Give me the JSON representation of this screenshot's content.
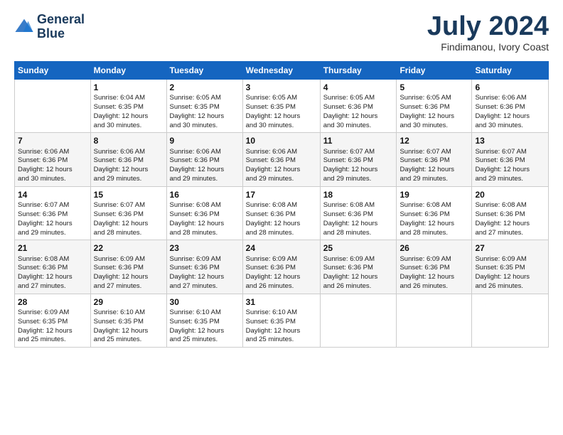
{
  "logo": {
    "line1": "General",
    "line2": "Blue"
  },
  "header": {
    "month": "July 2024",
    "location": "Findimanou, Ivory Coast"
  },
  "weekdays": [
    "Sunday",
    "Monday",
    "Tuesday",
    "Wednesday",
    "Thursday",
    "Friday",
    "Saturday"
  ],
  "weeks": [
    [
      {
        "day": "",
        "info": ""
      },
      {
        "day": "1",
        "info": "Sunrise: 6:04 AM\nSunset: 6:35 PM\nDaylight: 12 hours\nand 30 minutes."
      },
      {
        "day": "2",
        "info": "Sunrise: 6:05 AM\nSunset: 6:35 PM\nDaylight: 12 hours\nand 30 minutes."
      },
      {
        "day": "3",
        "info": "Sunrise: 6:05 AM\nSunset: 6:35 PM\nDaylight: 12 hours\nand 30 minutes."
      },
      {
        "day": "4",
        "info": "Sunrise: 6:05 AM\nSunset: 6:36 PM\nDaylight: 12 hours\nand 30 minutes."
      },
      {
        "day": "5",
        "info": "Sunrise: 6:05 AM\nSunset: 6:36 PM\nDaylight: 12 hours\nand 30 minutes."
      },
      {
        "day": "6",
        "info": "Sunrise: 6:06 AM\nSunset: 6:36 PM\nDaylight: 12 hours\nand 30 minutes."
      }
    ],
    [
      {
        "day": "7",
        "info": "Sunrise: 6:06 AM\nSunset: 6:36 PM\nDaylight: 12 hours\nand 30 minutes."
      },
      {
        "day": "8",
        "info": "Sunrise: 6:06 AM\nSunset: 6:36 PM\nDaylight: 12 hours\nand 29 minutes."
      },
      {
        "day": "9",
        "info": "Sunrise: 6:06 AM\nSunset: 6:36 PM\nDaylight: 12 hours\nand 29 minutes."
      },
      {
        "day": "10",
        "info": "Sunrise: 6:06 AM\nSunset: 6:36 PM\nDaylight: 12 hours\nand 29 minutes."
      },
      {
        "day": "11",
        "info": "Sunrise: 6:07 AM\nSunset: 6:36 PM\nDaylight: 12 hours\nand 29 minutes."
      },
      {
        "day": "12",
        "info": "Sunrise: 6:07 AM\nSunset: 6:36 PM\nDaylight: 12 hours\nand 29 minutes."
      },
      {
        "day": "13",
        "info": "Sunrise: 6:07 AM\nSunset: 6:36 PM\nDaylight: 12 hours\nand 29 minutes."
      }
    ],
    [
      {
        "day": "14",
        "info": "Sunrise: 6:07 AM\nSunset: 6:36 PM\nDaylight: 12 hours\nand 29 minutes."
      },
      {
        "day": "15",
        "info": "Sunrise: 6:07 AM\nSunset: 6:36 PM\nDaylight: 12 hours\nand 28 minutes."
      },
      {
        "day": "16",
        "info": "Sunrise: 6:08 AM\nSunset: 6:36 PM\nDaylight: 12 hours\nand 28 minutes."
      },
      {
        "day": "17",
        "info": "Sunrise: 6:08 AM\nSunset: 6:36 PM\nDaylight: 12 hours\nand 28 minutes."
      },
      {
        "day": "18",
        "info": "Sunrise: 6:08 AM\nSunset: 6:36 PM\nDaylight: 12 hours\nand 28 minutes."
      },
      {
        "day": "19",
        "info": "Sunrise: 6:08 AM\nSunset: 6:36 PM\nDaylight: 12 hours\nand 28 minutes."
      },
      {
        "day": "20",
        "info": "Sunrise: 6:08 AM\nSunset: 6:36 PM\nDaylight: 12 hours\nand 27 minutes."
      }
    ],
    [
      {
        "day": "21",
        "info": "Sunrise: 6:08 AM\nSunset: 6:36 PM\nDaylight: 12 hours\nand 27 minutes."
      },
      {
        "day": "22",
        "info": "Sunrise: 6:09 AM\nSunset: 6:36 PM\nDaylight: 12 hours\nand 27 minutes."
      },
      {
        "day": "23",
        "info": "Sunrise: 6:09 AM\nSunset: 6:36 PM\nDaylight: 12 hours\nand 27 minutes."
      },
      {
        "day": "24",
        "info": "Sunrise: 6:09 AM\nSunset: 6:36 PM\nDaylight: 12 hours\nand 26 minutes."
      },
      {
        "day": "25",
        "info": "Sunrise: 6:09 AM\nSunset: 6:36 PM\nDaylight: 12 hours\nand 26 minutes."
      },
      {
        "day": "26",
        "info": "Sunrise: 6:09 AM\nSunset: 6:36 PM\nDaylight: 12 hours\nand 26 minutes."
      },
      {
        "day": "27",
        "info": "Sunrise: 6:09 AM\nSunset: 6:35 PM\nDaylight: 12 hours\nand 26 minutes."
      }
    ],
    [
      {
        "day": "28",
        "info": "Sunrise: 6:09 AM\nSunset: 6:35 PM\nDaylight: 12 hours\nand 25 minutes."
      },
      {
        "day": "29",
        "info": "Sunrise: 6:10 AM\nSunset: 6:35 PM\nDaylight: 12 hours\nand 25 minutes."
      },
      {
        "day": "30",
        "info": "Sunrise: 6:10 AM\nSunset: 6:35 PM\nDaylight: 12 hours\nand 25 minutes."
      },
      {
        "day": "31",
        "info": "Sunrise: 6:10 AM\nSunset: 6:35 PM\nDaylight: 12 hours\nand 25 minutes."
      },
      {
        "day": "",
        "info": ""
      },
      {
        "day": "",
        "info": ""
      },
      {
        "day": "",
        "info": ""
      }
    ]
  ]
}
